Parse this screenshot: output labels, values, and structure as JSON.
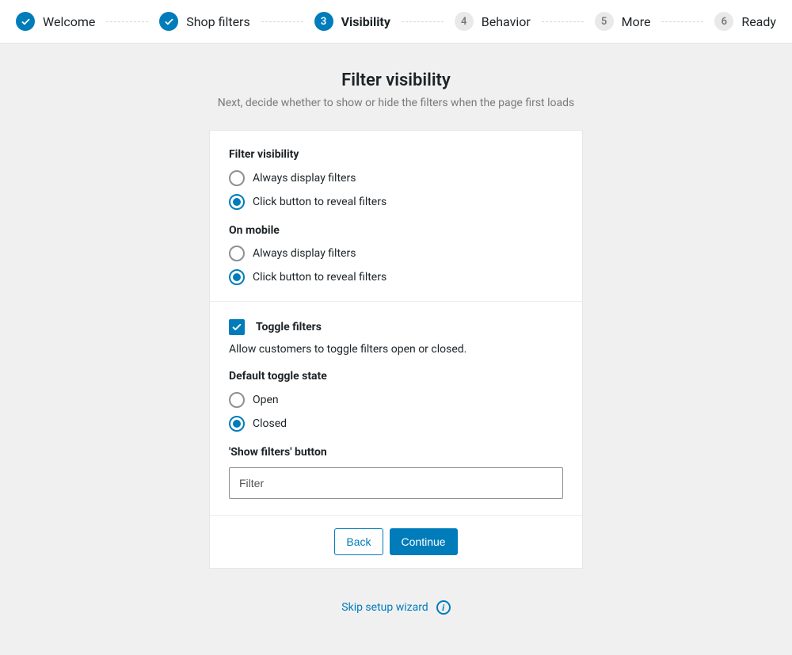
{
  "colors": {
    "accent": "#007cba"
  },
  "stepper": {
    "steps": [
      {
        "label": "Welcome",
        "state": "done",
        "num": "1"
      },
      {
        "label": "Shop filters",
        "state": "done",
        "num": "2"
      },
      {
        "label": "Visibility",
        "state": "current",
        "num": "3"
      },
      {
        "label": "Behavior",
        "state": "upcoming",
        "num": "4"
      },
      {
        "label": "More",
        "state": "upcoming",
        "num": "5"
      },
      {
        "label": "Ready",
        "state": "upcoming",
        "num": "6"
      }
    ]
  },
  "header": {
    "title": "Filter visibility",
    "subtitle": "Next, decide whether to show or hide the filters when the page first loads"
  },
  "section1": {
    "heading": "Filter visibility",
    "option1": "Always display filters",
    "option2": "Click button to reveal filters",
    "mobile_heading": "On mobile",
    "mobile_option1": "Always display filters",
    "mobile_option2": "Click button to reveal filters"
  },
  "section2": {
    "toggle_label": "Toggle filters",
    "toggle_desc": "Allow customers to toggle filters open or closed.",
    "default_heading": "Default toggle state",
    "default_opt1": "Open",
    "default_opt2": "Closed",
    "button_heading": "'Show filters' button",
    "button_value": "Filter"
  },
  "footer": {
    "back": "Back",
    "continue": "Continue"
  },
  "skip": {
    "label": "Skip setup wizard"
  }
}
